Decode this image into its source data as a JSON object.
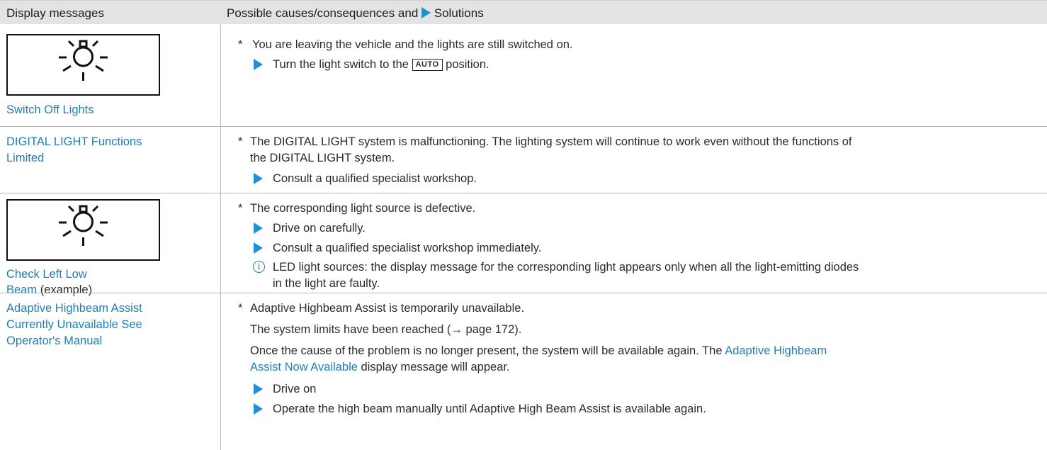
{
  "header": {
    "col1": "Display messages",
    "col2": "Possible causes/consequences and",
    "col2_solutions": "Solutions"
  },
  "rows": [
    {
      "message": "Switch Off Lights",
      "cause": "You are leaving the vehicle and the lights are still switched on.",
      "solution_pre": "Turn the light switch to the",
      "solution_key": "AUTO",
      "solution_post": "position.",
      "icon": "light-bulb-icon"
    },
    {
      "message_line1": "DIGITAL LIGHT Functions",
      "message_line2": "Limited",
      "cause_line1": "The DIGITAL LIGHT system is malfunctioning. The lighting system will continue to work even without the functions of",
      "cause_line2": "the DIGITAL LIGHT system.",
      "solution": "Consult a qualified specialist workshop."
    },
    {
      "message_line1": "Check Left Low",
      "message_line2": "Beam",
      "message_suffix": "(example)",
      "cause": "The corresponding light source is defective.",
      "solution1": "Drive on carefully.",
      "solution2": "Consult a qualified specialist workshop immediately.",
      "note_line1": "LED light sources: the display message for the corresponding light appears only when all the light-emitting diodes",
      "note_line2": "in the light are faulty.",
      "icon": "light-bulb-icon"
    },
    {
      "message_line1": "Adaptive Highbeam Assist",
      "message_line2": "Currently Unavailable See",
      "message_line3": "Operator's Manual",
      "cause": "Adaptive Highbeam Assist is temporarily unavailable.",
      "para1": "The system limits have been reached (→ page 172).",
      "para2_line1": "Once the cause of the problem is no longer present, the system will be available again. The",
      "para2_link1": "Adaptive Highbeam",
      "para2_link2": "Assist Now Available",
      "para2_line2_rest": "display message will appear.",
      "solution1": "Drive on",
      "solution2": "Operate the high beam manually until Adaptive High Beam Assist is available again."
    }
  ],
  "colors": {
    "link": "#1f7fb6",
    "arrow": "#1f8fd6",
    "header_bg": "#e3e3e3"
  }
}
